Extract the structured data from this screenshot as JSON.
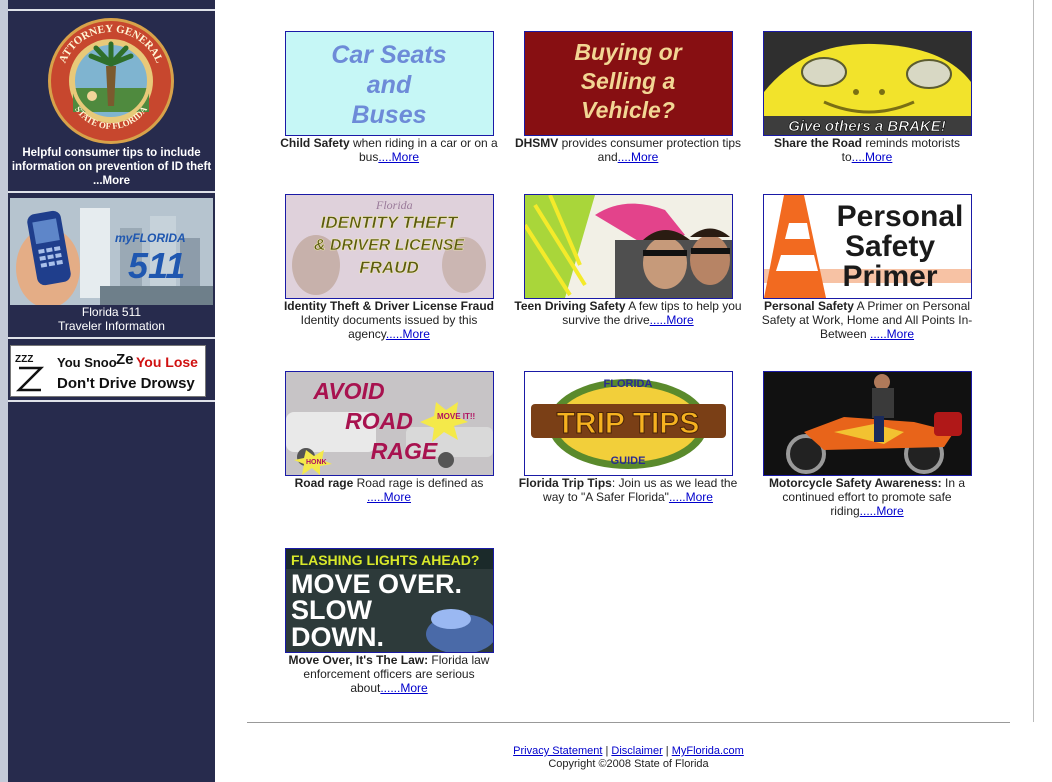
{
  "sidebar": {
    "seal_top_text": "ATTORNEY GENERAL",
    "seal_bottom_text": "STATE OF FLORIDA",
    "ag_caption": "Helpful consumer tips to include information on prevention of ID theft",
    "ag_more": "...More",
    "fl511_banner": "myFLORIDA",
    "fl511_number": "511",
    "fl511_title": "Florida 511",
    "fl511_subtitle": "Traveler Information",
    "snooze_line1_a": "You Snoo",
    "snooze_line1_b": "Ze",
    "snooze_line1_c": "You Lose",
    "snooze_line2": "Don't Drive Drowsy",
    "snooze_z": "ZZZ"
  },
  "tiles": [
    {
      "img_lines": [
        "Car Seats",
        "and",
        "Buses"
      ],
      "bold": "Child Safety",
      "text": " when riding in a car or on a bus",
      "more": "....More"
    },
    {
      "img_lines": [
        "Buying or",
        "Selling a",
        "Vehicle?"
      ],
      "bold": "DHSMV",
      "text": " provides consumer protection tips and",
      "more": "....More"
    },
    {
      "img_lines": [
        "Give others a BRAKE!"
      ],
      "bold": "Share the Road",
      "text": " reminds motorists to",
      "more": "....More"
    },
    {
      "img_lines": [
        "IDENTITY THEFT",
        "& DRIVER LICENSE",
        "FRAUD"
      ],
      "img_small": "Florida",
      "bold": "Identity Theft & Driver License Fraud",
      "text": " Identity documents issued by this agency",
      "more": ".....More"
    },
    {
      "img_lines": [],
      "bold": "Teen Driving Safety",
      "text": " A few tips to help you survive the drive",
      "more": ".....More"
    },
    {
      "img_lines": [
        "Personal",
        "Safety",
        "Primer"
      ],
      "bold": "Personal Safety",
      "text": " A Primer on Personal Safety at Work, Home and All Points In-Between ",
      "more": ".....More"
    },
    {
      "img_lines": [
        "AVOID",
        "ROAD",
        "RAGE"
      ],
      "img_small": "MOVE IT!!",
      "img_small2": "HONK",
      "bold": "Road rage",
      "text": " Road rage is defined as ",
      "more": ".....More"
    },
    {
      "img_lines": [
        "TRIP TIPS"
      ],
      "img_small": "FLORIDA",
      "img_small2": "GUIDE",
      "bold": "Florida Trip Tips",
      "text": ": Join us as we lead the way to \"A Safer Florida\"",
      "more": ".....More"
    },
    {
      "img_lines": [],
      "bold": "Motorcycle Safety Awareness:",
      "text": " In a continued effort to promote safe riding",
      "more": ".....More"
    },
    {
      "img_lines": [
        "FLASHING LIGHTS AHEAD?",
        "MOVE OVER.",
        "SLOW",
        "DOWN."
      ],
      "bold": "Move Over, It's The Law:",
      "text": " Florida law enforcement officers are serious about",
      "more": "......More"
    }
  ],
  "footer": {
    "privacy": "Privacy Statement",
    "sep1": " | ",
    "disclaimer": "Disclaimer",
    "sep2": " | ",
    "myflorida": "MyFlorida.com",
    "copyright": "Copyright ©2008 State of Florida"
  },
  "colors": {
    "sidebar_bg": "#272b4d",
    "link": "#0000cc",
    "tile_border": "#1a1aa6"
  }
}
